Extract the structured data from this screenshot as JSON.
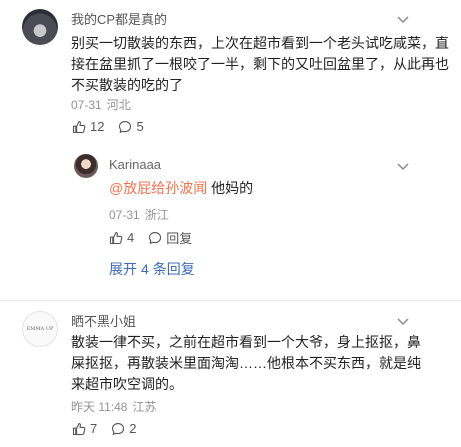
{
  "comments": [
    {
      "username": "我的CP都是真的",
      "text": "别买一切散装的东西，上次在超市看到一个老头试吃咸菜，直接在盆里抓了一根咬了一半，剩下的又吐回盆里了，从此再也不买散装的吃的了",
      "date": "07-31",
      "location": "河北",
      "likes": "12",
      "replies_count": "5",
      "reply": {
        "username": "Karinaaa",
        "mention": "@放屁给孙波闻",
        "text": " 他妈的",
        "date": "07-31",
        "location": "浙江",
        "likes": "4",
        "reply_label": "回复"
      },
      "expand_label": "展开",
      "expand_count": "4",
      "expand_suffix": "条回复"
    },
    {
      "username": "晒不黑小姐",
      "avatar_text": "EMMA UP",
      "text": "散装一律不买，之前在超市看到一个大爷，身上抠抠，鼻屎抠抠，再散装米里面淘淘……他根本不买东西，就是纯来超市吹空调的。",
      "date": "昨天 11:48",
      "location": "江苏",
      "likes": "7",
      "replies_count": "2"
    }
  ],
  "icons": {
    "more": "chevron-down-icon",
    "like": "thumbs-up-icon",
    "comment": "comment-bubble-icon"
  },
  "colors": {
    "link": "#3f6bb3",
    "mention": "#eb7350",
    "meta": "#939393"
  }
}
